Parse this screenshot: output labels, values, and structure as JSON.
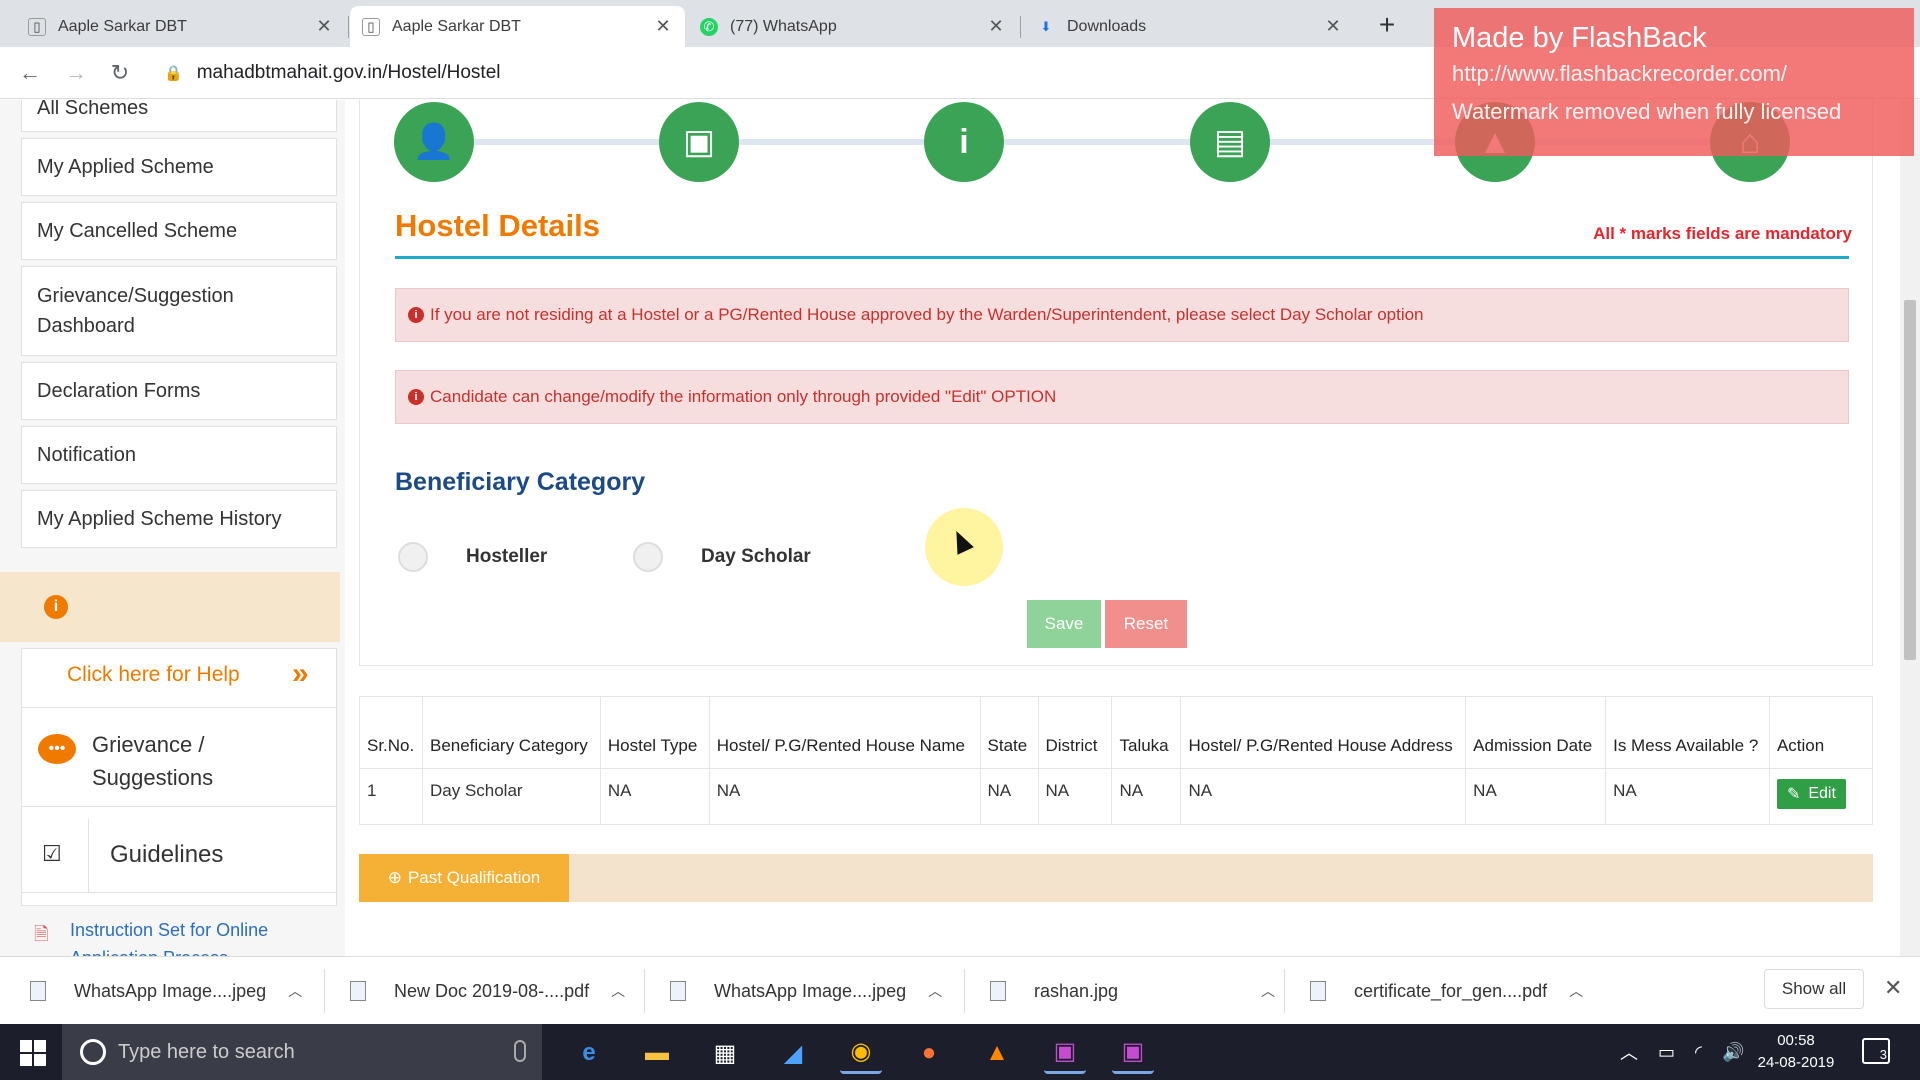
{
  "browser": {
    "tabs": [
      {
        "title": "Aaple Sarkar DBT",
        "active": false,
        "icon": "page-icon"
      },
      {
        "title": "Aaple Sarkar DBT",
        "active": true,
        "icon": "page-icon"
      },
      {
        "title": "(77) WhatsApp",
        "active": false,
        "icon": "whatsapp-icon"
      },
      {
        "title": "Downloads",
        "active": false,
        "icon": "download-icon"
      }
    ],
    "url": "mahadbtmahait.gov.in/Hostel/Hostel"
  },
  "watermark": {
    "line1": "Made by FlashBack",
    "line2": "http://www.flashbackrecorder.com/",
    "line3": "Watermark removed when fully licensed"
  },
  "sidebar": {
    "items": [
      {
        "label": "All Schemes"
      },
      {
        "label": "My Applied Scheme"
      },
      {
        "label": "My Cancelled Scheme"
      },
      {
        "label": "Grievance/Suggestion Dashboard"
      },
      {
        "label": "Declaration Forms"
      },
      {
        "label": "Notification"
      },
      {
        "label": "My Applied Scheme History"
      }
    ],
    "help_link": "Click here for Help",
    "grievance_label": "Grievance / Suggestions",
    "guidelines_label": "Guidelines",
    "instruction_link": "Instruction Set for Online Application Process"
  },
  "main": {
    "section_title": "Hostel Details",
    "mandatory_note": "All * marks fields are mandatory",
    "alerts": [
      "If you are not residing at a Hostel or a PG/Rented House approved by the Warden/Superintendent, please select Day Scholar option",
      "Candidate can change/modify the information only through provided \"Edit\" OPTION"
    ],
    "category_title": "Beneficiary Category",
    "options": [
      "Hosteller",
      "Day Scholar"
    ],
    "save_label": "Save",
    "reset_label": "Reset",
    "table": {
      "headers": [
        "Sr.No.",
        "Beneficiary Category",
        "Hostel Type",
        "Hostel/ P.G/Rented House Name",
        "State",
        "District",
        "Taluka",
        "Hostel/ P.G/Rented House Address",
        "Admission Date",
        "Is Mess Available ?",
        "Action"
      ],
      "rows": [
        [
          "1",
          "Day Scholar",
          "NA",
          "NA",
          "NA",
          "NA",
          "NA",
          "NA",
          "NA",
          "NA"
        ]
      ],
      "edit_label": "Edit"
    },
    "past_qualification_label": "Past Qualification"
  },
  "downloads": {
    "items": [
      "WhatsApp Image....jpeg",
      "New Doc 2019-08-....pdf",
      "WhatsApp Image....jpeg",
      "rashan.jpg",
      "certificate_for_gen....pdf"
    ],
    "show_all": "Show all"
  },
  "taskbar": {
    "search_placeholder": "Type here to search",
    "time": "00:58",
    "date": "24-08-2019",
    "notifications": "3"
  },
  "colors": {
    "accent_orange": "#f07a00",
    "step_green": "#3aa356",
    "title_blue": "#1c4a86",
    "alert_red": "#c9302c"
  }
}
